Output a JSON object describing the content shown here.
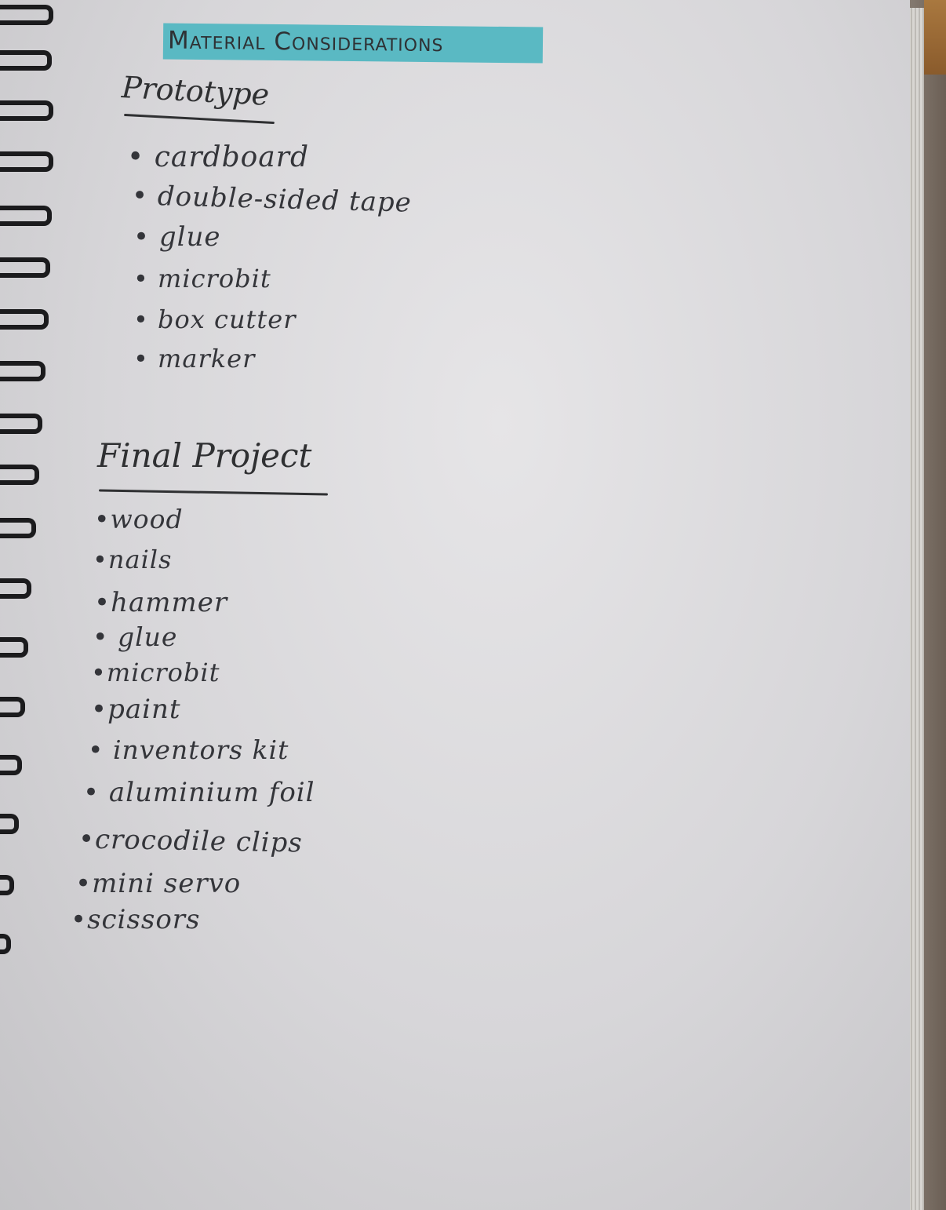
{
  "heading": "Material Considerations",
  "prototype": {
    "title": "Prototype",
    "items": [
      "cardboard",
      "double-sided tape",
      "glue",
      "microbit",
      "box cutter",
      "marker"
    ]
  },
  "final_project": {
    "title": "Final Project",
    "items": [
      "wood",
      "nails",
      "hammer",
      "glue",
      "microbit",
      "paint",
      "inventors kit",
      "aluminium foil",
      "crocodile clips",
      "mini servo",
      "scissors"
    ]
  },
  "colors": {
    "highlight": "#5ab9c3",
    "ink": "#2f3032",
    "paper": "#dcdbde"
  }
}
